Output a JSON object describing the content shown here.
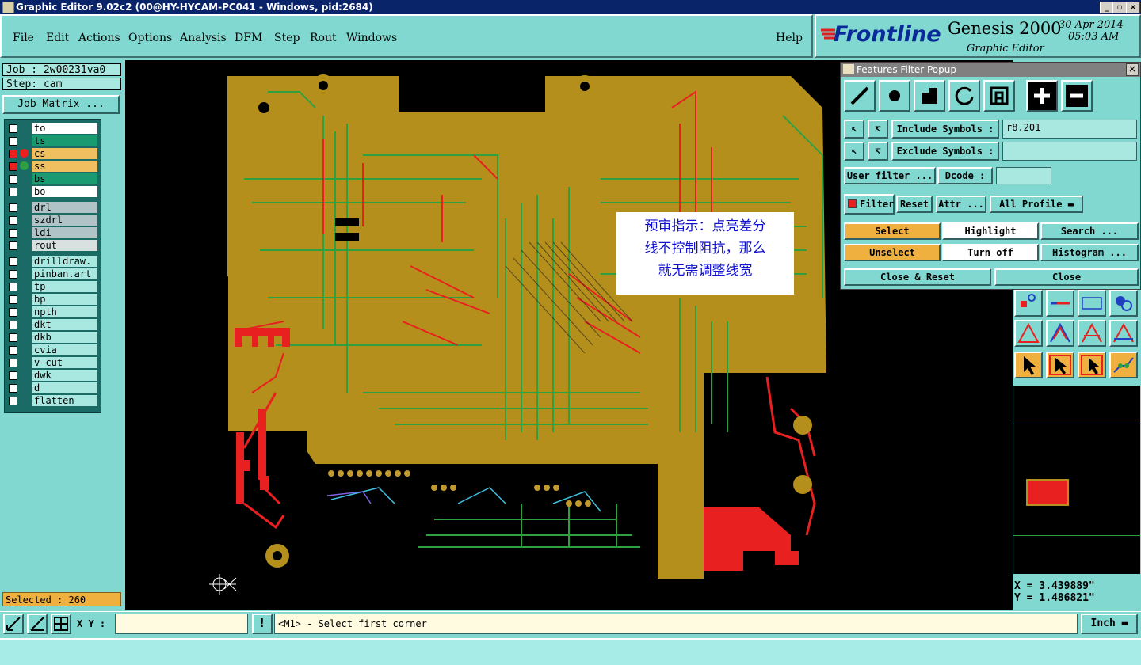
{
  "window": {
    "title": "Graphic Editor 9.02c2 (00@HY-HYCAM-PC041 - Windows, pid:2684)"
  },
  "menu": {
    "items": [
      "File",
      "Edit",
      "Actions",
      "Options",
      "Analysis",
      "DFM",
      "Step",
      "Rout",
      "Windows"
    ],
    "help": "Help"
  },
  "brand": {
    "logo": "Frontline",
    "product": "Genesis 2000",
    "date": "30 Apr 2014",
    "time": "05:03 AM",
    "subtitle": "Graphic Editor"
  },
  "job": {
    "job_label": "Job : 2w00231va0",
    "step_label": "Step: cam",
    "matrix_button": "Job Matrix ..."
  },
  "layers": [
    {
      "name": "to",
      "color": "#ffffff"
    },
    {
      "name": "ts",
      "color": "#1a9a70"
    },
    {
      "name": "cs",
      "color": "#f0c060"
    },
    {
      "name": "ss",
      "color": "#f0c060"
    },
    {
      "name": "bs",
      "color": "#1a9a70"
    },
    {
      "name": "bo",
      "color": "#ffffff"
    },
    {
      "name": "drl",
      "color": "#b0c4c8"
    },
    {
      "name": "szdrl",
      "color": "#b0c4c8"
    },
    {
      "name": "ldi",
      "color": "#b0c4c8"
    },
    {
      "name": "rout",
      "color": "#d8e0e0"
    },
    {
      "name": "drilldraw.",
      "color": "#a8e8e0"
    },
    {
      "name": "pinban.art",
      "color": "#a8e8e0"
    },
    {
      "name": "tp",
      "color": "#a8e8e0"
    },
    {
      "name": "bp",
      "color": "#a8e8e0"
    },
    {
      "name": "npth",
      "color": "#a8e8e0"
    },
    {
      "name": "dkt",
      "color": "#a8e8e0"
    },
    {
      "name": "dkb",
      "color": "#a8e8e0"
    },
    {
      "name": "cvia",
      "color": "#a8e8e0"
    },
    {
      "name": "v-cut",
      "color": "#a8e8e0"
    },
    {
      "name": "dwk",
      "color": "#a8e8e0"
    },
    {
      "name": "d",
      "color": "#a8e8e0"
    },
    {
      "name": "flatten",
      "color": "#a8e8e0"
    }
  ],
  "selected": "Selected : 260",
  "annotation": {
    "line1": "预审指示：点亮差分",
    "line2": "线不控制阻抗，那么",
    "line3": "就无需调整线宽"
  },
  "popup": {
    "title": "Features Filter Popup",
    "include_label": "Include Symbols :",
    "include_value": "r8.201",
    "exclude_label": "Exclude Symbols :",
    "exclude_value": "",
    "user_filter": "User filter ...",
    "dcode": "Dcode :",
    "dcode_value": "",
    "filter": "Filter",
    "reset": "Reset",
    "attr": "Attr ...",
    "profile": "All Profile",
    "select": "Select",
    "highlight": "Highlight",
    "search": "Search ...",
    "unselect": "Unselect",
    "turn_off": "Turn off",
    "histogram": "Histogram ...",
    "close_reset": "Close & Reset",
    "close": "Close"
  },
  "coords": {
    "x": "X = 3.439889\"",
    "y": "Y = 1.486821\""
  },
  "status": {
    "xy_label": "X Y :",
    "xy_value": "",
    "prompt": "<M1> - Select first corner",
    "units": "Inch"
  },
  "colors": {
    "board": "#b58f1c",
    "trace_green": "#2ea040",
    "trace_red": "#e82020",
    "accent_orange": "#f0b040"
  }
}
